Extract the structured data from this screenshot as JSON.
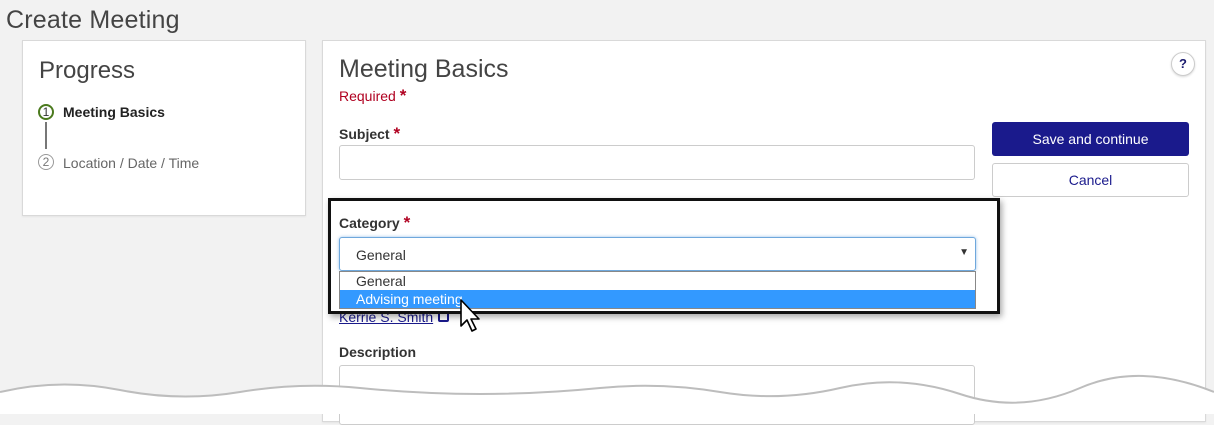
{
  "page": {
    "title": "Create Meeting"
  },
  "progress": {
    "title": "Progress",
    "steps": [
      {
        "number": "1",
        "label": "Meeting Basics"
      },
      {
        "number": "2",
        "label": "Location / Date / Time"
      }
    ]
  },
  "form": {
    "title": "Meeting Basics",
    "required_note": "Required",
    "required_marker": "*",
    "help_label": "?",
    "subject": {
      "label": "Subject",
      "value": ""
    },
    "category": {
      "label": "Category",
      "selected": "General",
      "options": [
        "General",
        "Advising meeting"
      ],
      "highlighted_option": "Advising meeting"
    },
    "advisor_link": "Kerrie S. Smith",
    "description": {
      "label": "Description",
      "value": ""
    },
    "save_label": "Save and continue",
    "cancel_label": "Cancel"
  },
  "icons": {
    "help": "help-icon",
    "dropdown": "chevron-down-icon",
    "external_link": "external-link-icon",
    "cursor": "mouse-pointer-icon"
  },
  "colors": {
    "primary": "#1a1a8c",
    "required": "#b00020",
    "progress_active": "#4b7a1e",
    "option_highlight": "#3399ff"
  }
}
